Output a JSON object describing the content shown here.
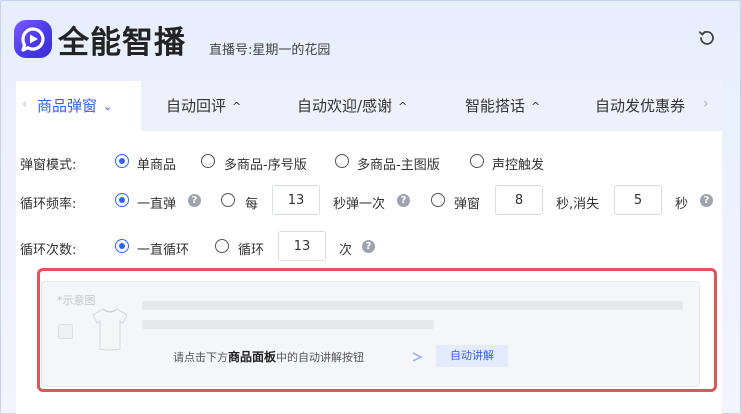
{
  "header": {
    "brand": "全能智播",
    "room": "直播号:星期一的花园",
    "refresh_icon": "refresh-icon"
  },
  "tabs": [
    {
      "label": "商品弹窗",
      "caret": "⌄",
      "active": true
    },
    {
      "label": "自动回评",
      "caret": "^",
      "active": false
    },
    {
      "label": "自动欢迎/感谢",
      "caret": "^",
      "active": false
    },
    {
      "label": "智能搭话",
      "caret": "^",
      "active": false
    },
    {
      "label": "自动发优惠券",
      "active": false
    }
  ],
  "popup_mode": {
    "label": "弹窗模式:",
    "options": [
      "单商品",
      "多商品-序号版",
      "多商品-主图版",
      "声控触发"
    ],
    "selected": "单商品"
  },
  "loop_freq": {
    "label": "循环频率:",
    "opt_always": "一直弹",
    "opt_every": "每",
    "every_value": "13",
    "every_suffix": "秒弹一次",
    "opt_popup": "弹窗",
    "popup_value": "8",
    "popup_suffix": "秒,消失",
    "vanish_value": "5",
    "vanish_suffix": "秒",
    "selected": "一直弹"
  },
  "loop_count": {
    "label": "循环次数:",
    "opt_always": "一直循环",
    "opt_loop": "循环",
    "loop_value": "13",
    "loop_suffix": "次",
    "selected": "一直循环"
  },
  "preview": {
    "title": "*示意图",
    "hint_pre": "请点击下方",
    "hint_bold": "商品面板",
    "hint_post": "中的自动讲解按钮",
    "button_label": "自动讲解"
  },
  "colors": {
    "accent": "#3361f2",
    "highlight_border": "#e0545a"
  }
}
